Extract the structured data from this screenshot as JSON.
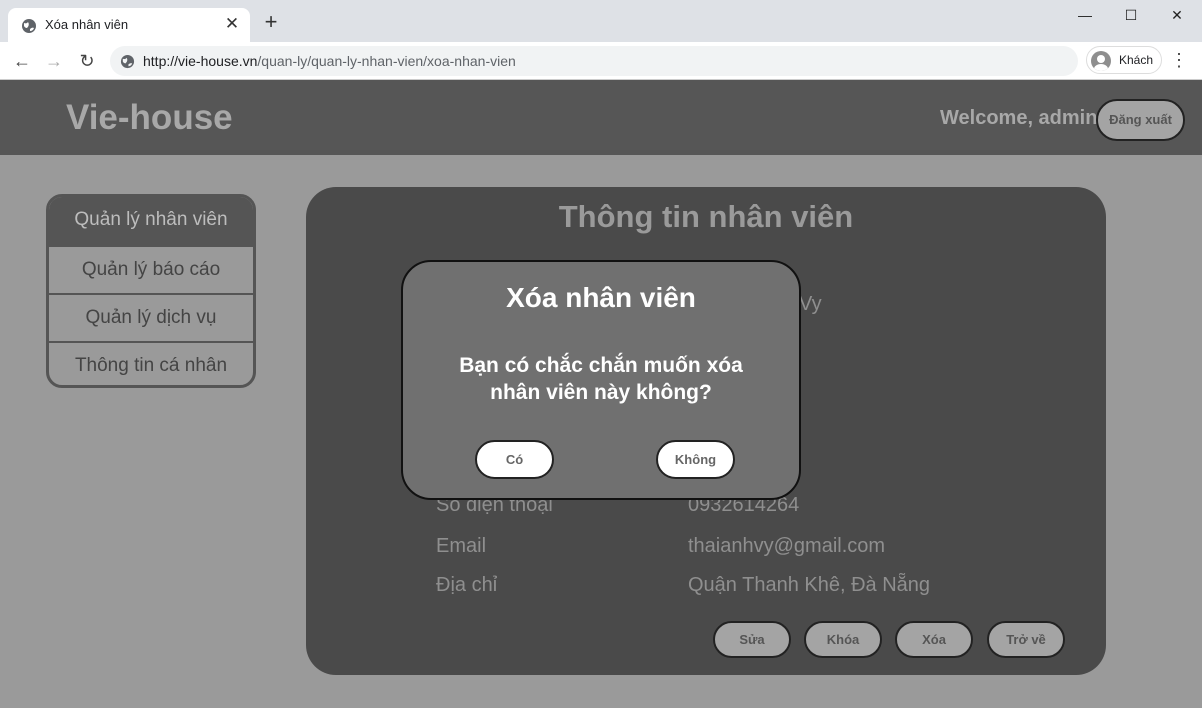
{
  "browser": {
    "tab_title": "Xóa nhân viên",
    "tab_close": "✕",
    "new_tab": "+",
    "url_host": "http://vie-house.vn",
    "url_path": "/quan-ly/quan-ly-nhan-vien/xoa-nhan-vien",
    "profile_label": "Khách",
    "window_controls": [
      "—",
      "☐",
      "✕"
    ]
  },
  "header": {
    "logo": "Vie-house",
    "welcome": "Welcome, admin",
    "logout": "Đăng xuất"
  },
  "sidebar": {
    "items": [
      {
        "label": "Quản lý nhân viên",
        "active": true
      },
      {
        "label": "Quản lý báo cáo"
      },
      {
        "label": "Quản lý dịch vụ"
      },
      {
        "label": "Thông tin cá nhân"
      }
    ]
  },
  "card": {
    "title": "Thông tin nhân viên",
    "rows_visible": [
      {
        "label": "Số điện thoại",
        "value": "0932614264"
      },
      {
        "label": "Email",
        "value": "thaianhvy@gmail.com"
      },
      {
        "label": "Địa chỉ",
        "value": "Quận Thanh Khê, Đà Nẵng"
      }
    ],
    "partial_value": "Vy",
    "actions": [
      "Sửa",
      "Khóa",
      "Xóa",
      "Trở về"
    ]
  },
  "modal": {
    "title": "Xóa nhân viên",
    "message": "Bạn có chắc chắn muốn xóa nhân viên này không?",
    "yes": "Có",
    "no": "Không"
  },
  "colors": {
    "header_bg": "#565656",
    "card_bg": "#4a4a4a",
    "modal_bg": "#707070",
    "page_bg": "#9a9a9a"
  }
}
